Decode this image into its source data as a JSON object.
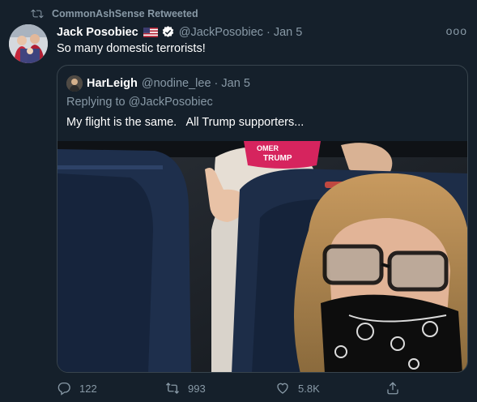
{
  "retweet": {
    "label": "CommonAshSense Retweeted"
  },
  "tweet": {
    "author_name": "Jack Posobiec",
    "handle_date": "@JackPosobiec · Jan 5",
    "text": "So many domestic terrorists!",
    "more_label": "ooo"
  },
  "quote": {
    "author_name": "HarLeigh",
    "handle_date": "@nodine_lee · Jan 5",
    "reply_line": "Replying to @JackPosobiec",
    "text": "My flight is the same.   All Trump supporters...",
    "photo_hat_text_1": "OMER",
    "photo_hat_text_2": "TRUMP"
  },
  "actions": {
    "reply_count": "122",
    "retweet_count": "993",
    "like_count": "5.8K"
  },
  "colors": {
    "background": "#15202b",
    "secondary_text": "#8899a6",
    "border": "#38444d"
  }
}
